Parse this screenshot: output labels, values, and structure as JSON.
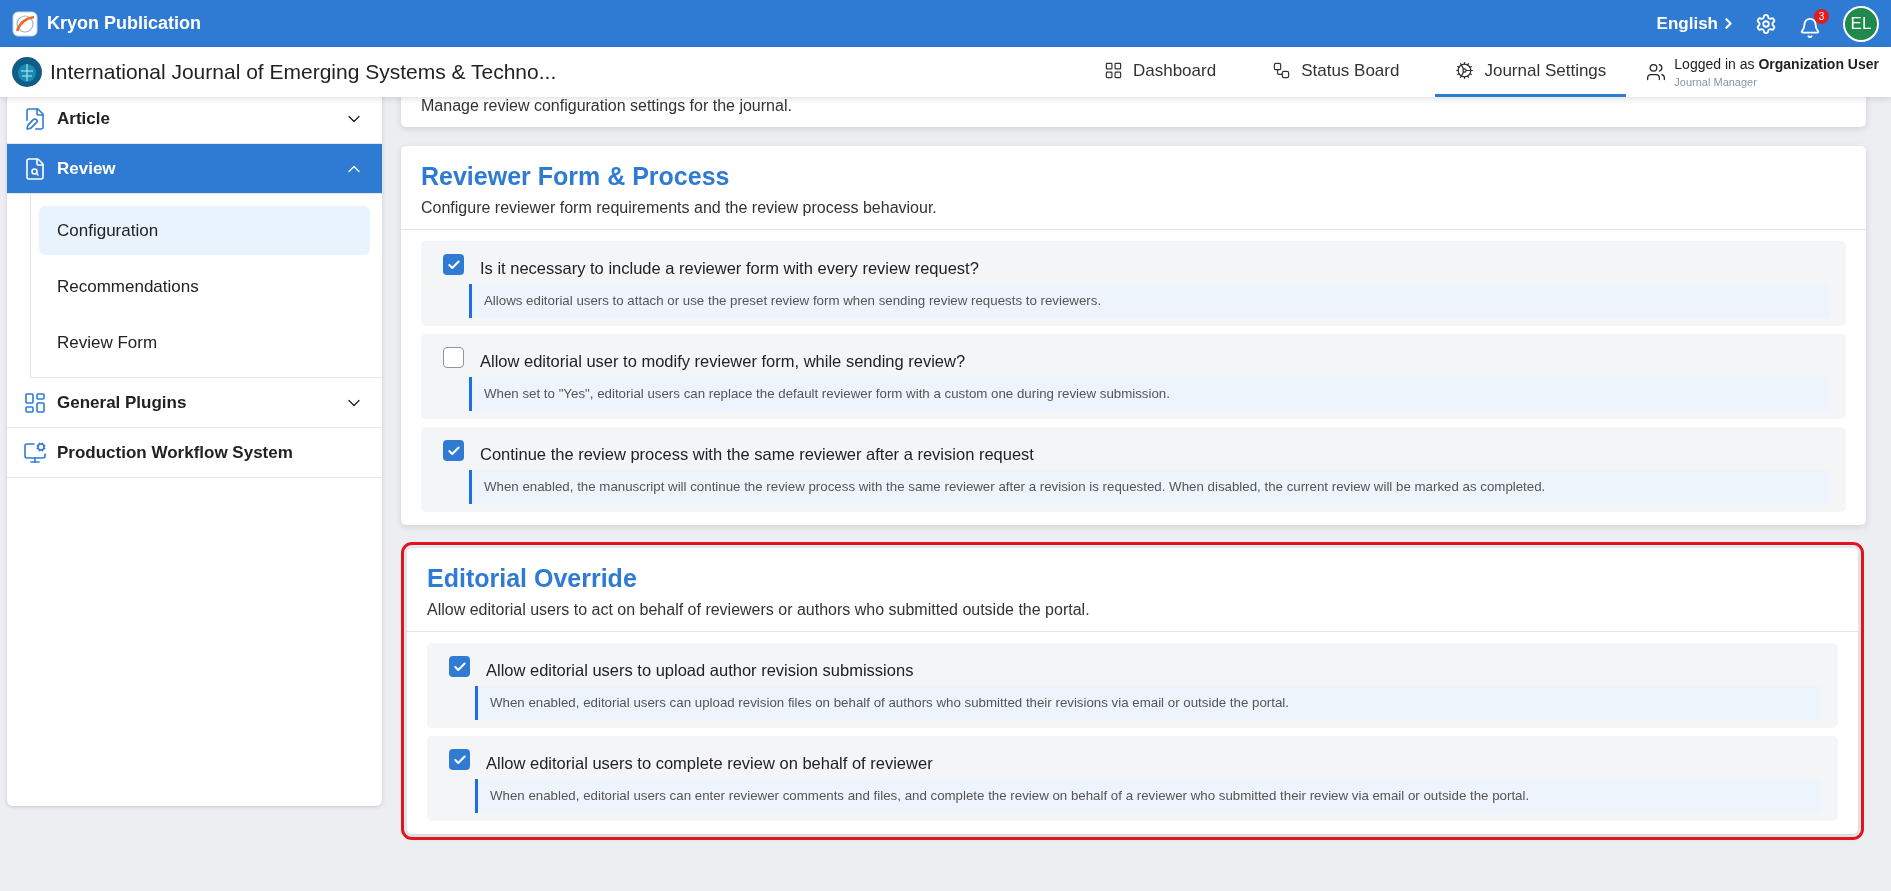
{
  "app_bar": {
    "title": "Kryon Publication",
    "language": "English",
    "notification_count": "3",
    "avatar_initials": "EL"
  },
  "journal_header": {
    "title": "International Journal of Emerging Systems & Techno...",
    "nav": [
      {
        "label": "Dashboard",
        "selected": false
      },
      {
        "label": "Status Board",
        "selected": false
      },
      {
        "label": "Journal Settings",
        "selected": true
      }
    ],
    "user": {
      "prefix": "Logged in as",
      "name": "Organization User",
      "role": "Journal Manager"
    }
  },
  "sidebar": {
    "items": [
      {
        "label": "Article",
        "kind": "group",
        "selected": false,
        "expanded": false
      },
      {
        "label": "Review",
        "kind": "group",
        "selected": true,
        "expanded": true,
        "children": [
          {
            "label": "Configuration",
            "selected": true
          },
          {
            "label": "Recommendations",
            "selected": false
          },
          {
            "label": "Review Form",
            "selected": false
          }
        ]
      },
      {
        "label": "General Plugins",
        "kind": "group",
        "selected": false,
        "expanded": false
      },
      {
        "label": "Production Workflow System",
        "kind": "link",
        "selected": false
      }
    ]
  },
  "sections": [
    {
      "description": "Manage review configuration settings for the journal.",
      "highlighted": false
    },
    {
      "title": "Reviewer Form & Process",
      "description": "Configure reviewer form requirements and the review process behaviour.",
      "highlighted": false,
      "options": [
        {
          "label": "Is it necessary to include a reviewer form with every review request?",
          "description": "Allows editorial users to attach or use the preset review form when sending review requests to reviewers.",
          "checked": true
        },
        {
          "label": "Allow editorial user to modify reviewer form, while sending review?",
          "description": "When set to \"Yes\", editorial users can replace the default reviewer form with a custom one during review submission.",
          "checked": false
        },
        {
          "label": "Continue the review process with the same reviewer after a revision request",
          "description": "When enabled, the manuscript will continue the review process with the same reviewer after a revision is requested. When disabled, the current review will be marked as completed.",
          "checked": true
        }
      ]
    },
    {
      "title": "Editorial Override",
      "description": "Allow editorial users to act on behalf of reviewers or authors who submitted outside the portal.",
      "highlighted": true,
      "options": [
        {
          "label": "Allow editorial users to upload author revision submissions",
          "description": "When enabled, editorial users can upload revision files on behalf of authors who submitted their revisions via email or outside the portal.",
          "checked": true
        },
        {
          "label": "Allow editorial users to complete review on behalf of reviewer",
          "description": "When enabled, editorial users can enter reviewer comments and files, and complete the review on behalf of a reviewer who submitted their review via email or outside the portal.",
          "checked": true
        }
      ]
    }
  ]
}
